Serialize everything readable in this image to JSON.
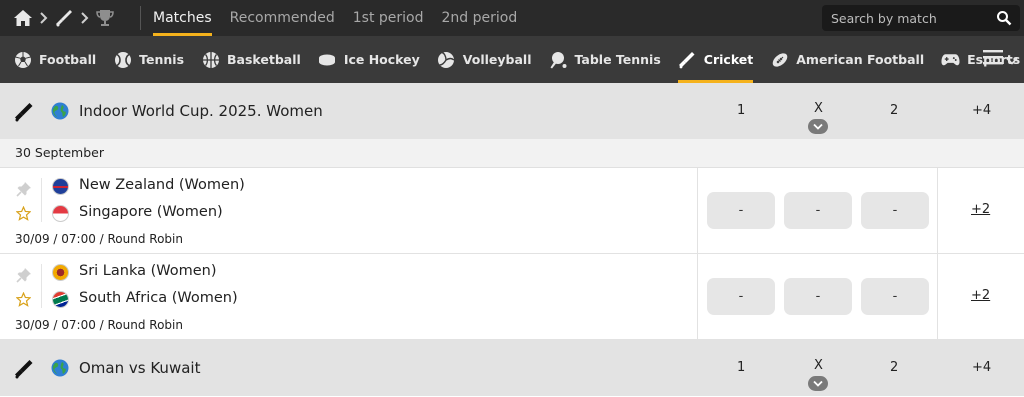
{
  "topbar": {
    "tabs": [
      {
        "label": "Matches",
        "active": true
      },
      {
        "label": "Recommended",
        "active": false
      },
      {
        "label": "1st period",
        "active": false
      },
      {
        "label": "2nd period",
        "active": false
      }
    ],
    "search": {
      "placeholder": "Search by match"
    }
  },
  "sports": [
    {
      "label": "Football",
      "icon": "football-icon"
    },
    {
      "label": "Tennis",
      "icon": "tennis-icon"
    },
    {
      "label": "Basketball",
      "icon": "basketball-icon"
    },
    {
      "label": "Ice Hockey",
      "icon": "ice-hockey-icon"
    },
    {
      "label": "Volleyball",
      "icon": "volleyball-icon"
    },
    {
      "label": "Table Tennis",
      "icon": "table-tennis-icon"
    },
    {
      "label": "Cricket",
      "icon": "cricket-icon",
      "active": true
    },
    {
      "label": "American Football",
      "icon": "american-football-icon"
    },
    {
      "label": "Esports",
      "icon": "gamepad-icon"
    }
  ],
  "colors": {
    "accent": "#f5b21c",
    "topbar": "#2a2a2a",
    "sportbar": "#3a3a3a",
    "league_bg": "#e3e3e3"
  },
  "leagues": [
    {
      "name": "Indoor World Cup. 2025. Women",
      "col1": "1",
      "colx": "X",
      "col2": "2",
      "more": "+4",
      "date": "30 September",
      "matches": [
        {
          "team1": "New Zealand (Women)",
          "team2": "Singapore (Women)",
          "meta": "30/09 / 07:00 / Round Robin",
          "odds": [
            "-",
            "-",
            "-"
          ],
          "more": "+2"
        },
        {
          "team1": "Sri Lanka (Women)",
          "team2": "South Africa (Women)",
          "meta": "30/09 / 07:00 / Round Robin",
          "odds": [
            "-",
            "-",
            "-"
          ],
          "more": "+2"
        }
      ]
    },
    {
      "name": "Oman vs Kuwait",
      "col1": "1",
      "colx": "X",
      "col2": "2",
      "more": "+4"
    }
  ]
}
